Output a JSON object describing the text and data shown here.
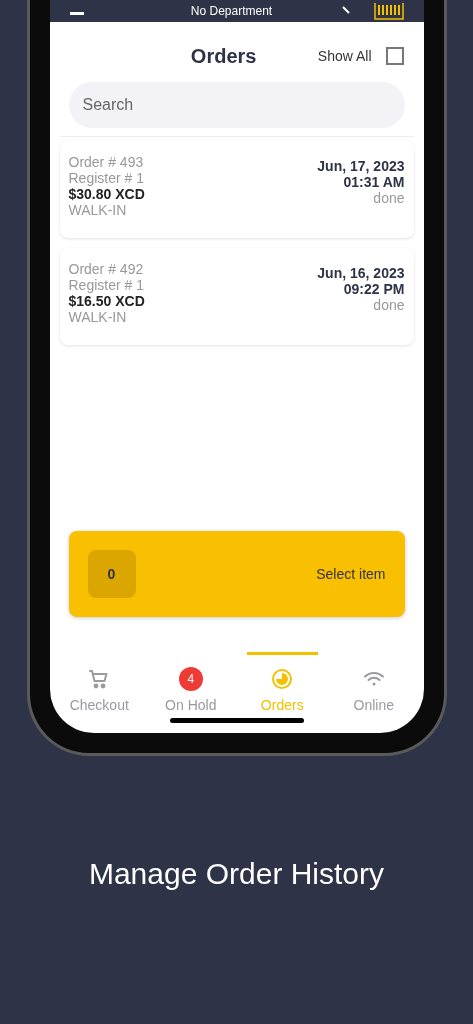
{
  "header": {
    "title": "No Department"
  },
  "page": {
    "title": "Orders",
    "show_all": {
      "label": "Show All",
      "checked": false
    }
  },
  "search": {
    "placeholder": "Search"
  },
  "orders": [
    {
      "number": "Order # 493",
      "register": "Register # 1",
      "total": "$30.80 XCD",
      "customer": "WALK-IN",
      "date": "Jun, 17, 2023",
      "time": "01:31 AM",
      "status": "done"
    },
    {
      "number": "Order # 492",
      "register": "Register # 1",
      "total": "$16.50 XCD",
      "customer": "WALK-IN",
      "date": "Jun, 16, 2023",
      "time": "09:22 PM",
      "status": "done"
    }
  ],
  "cart_bar": {
    "count": "0",
    "label": "Select item"
  },
  "tabs": [
    {
      "label": "Checkout",
      "selected": false
    },
    {
      "label": "On Hold",
      "selected": false,
      "badge": "4"
    },
    {
      "label": "Orders",
      "selected": true
    },
    {
      "label": "Online",
      "selected": false
    }
  ],
  "caption": "Manage Order History"
}
